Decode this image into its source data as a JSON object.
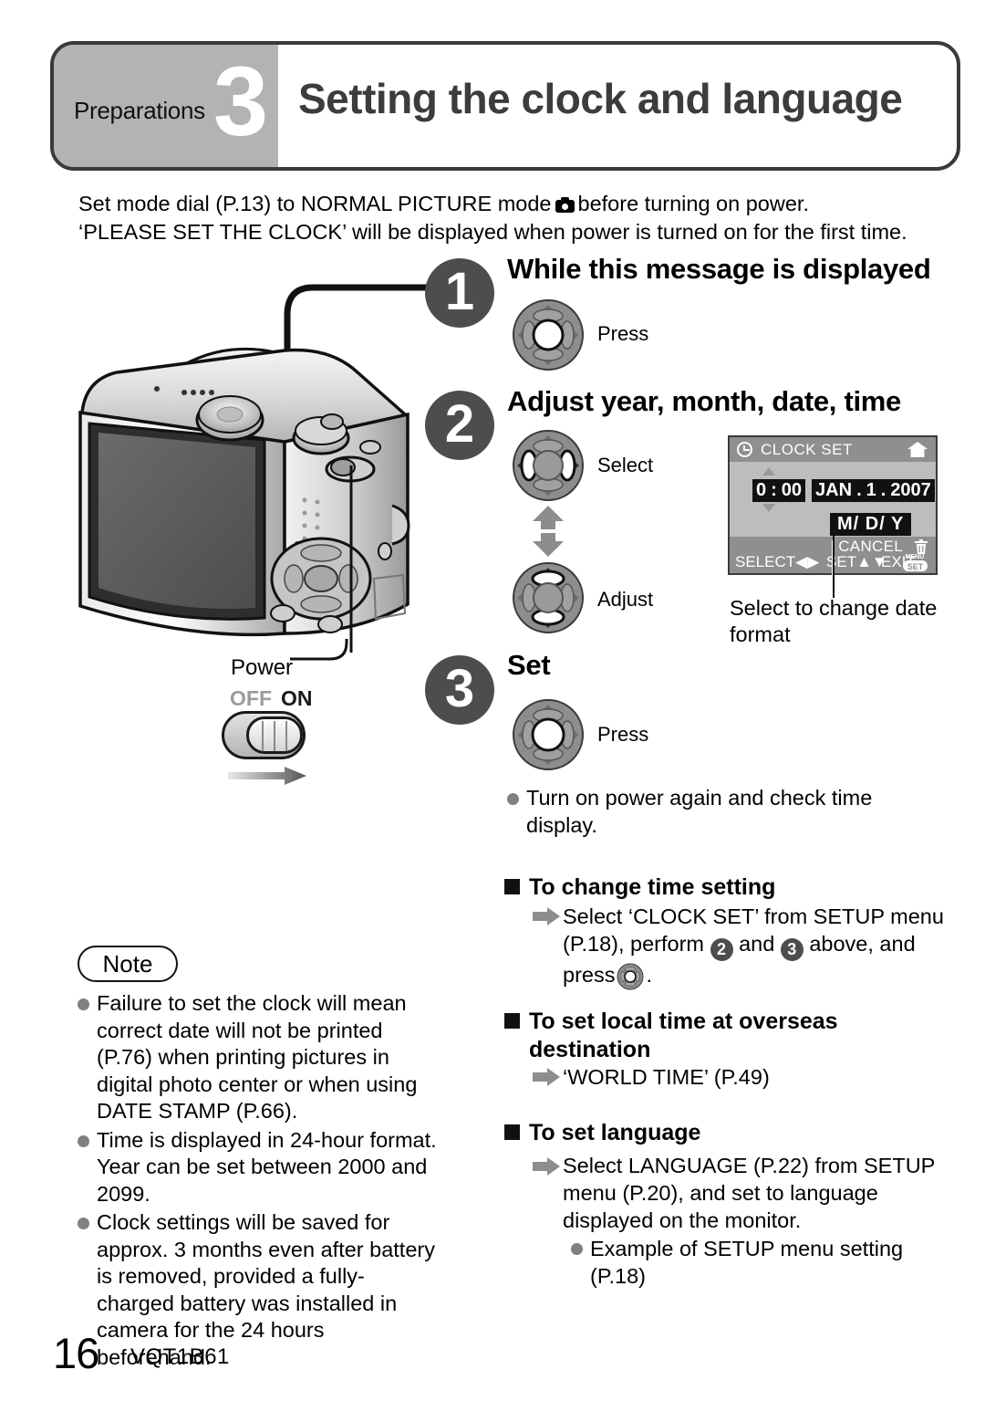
{
  "header": {
    "section_label": "Preparations",
    "step_number": "3",
    "title": "Setting the clock and language"
  },
  "intro": {
    "line1_before": "Set mode dial (P.13) to NORMAL PICTURE mode",
    "line1_after": "before turning on power.",
    "line2": "‘PLEASE SET THE CLOCK’ will be displayed when power is turned on for the first time."
  },
  "steps": [
    {
      "number": "1",
      "heading": "While this message is displayed",
      "action_label": "Press"
    },
    {
      "number": "2",
      "heading": "Adjust year, month, date, time",
      "action_label_top": "Select",
      "action_label_bottom": "Adjust"
    },
    {
      "number": "3",
      "heading": "Set",
      "action_label": "Press"
    }
  ],
  "lcd": {
    "title": "CLOCK SET",
    "clock_icon": "clock-icon",
    "home_icon": "home-icon",
    "time_hour": "0",
    "time_sep": ":",
    "time_minute": "00",
    "month": "JAN",
    "dot1": ".",
    "day": "1",
    "dot2": ".",
    "year": "2007",
    "date_format": "M/ D/ Y",
    "cancel_label": "CANCEL",
    "trash_icon": "trash-icon",
    "select_label": "SELECT",
    "set_label": "SET",
    "exit_label": "EXIT",
    "menu_set_top": "MENU",
    "menu_set_bottom": "SET",
    "caption": "Select to change date format"
  },
  "power": {
    "label": "Power",
    "off_label": "OFF",
    "on_label": "ON"
  },
  "turn_on_note": "Turn on power again and check time display.",
  "note": {
    "badge": "Note",
    "items": [
      "Failure to set the clock will mean correct date will not be printed (P.76) when printing pictures in digital photo center or when using DATE STAMP (P.66).",
      "Time is displayed in 24-hour format. Year can be set between 2000 and 2099.",
      "Clock settings will be saved for approx. 3 months even after battery is removed, provided a fully-charged battery was installed in camera for the 24 hours beforehand."
    ]
  },
  "sections": {
    "change_time": {
      "heading": "To change time setting",
      "body_part1": "Select ‘CLOCK SET’ from SETUP menu (P.18), perform",
      "step_a": "2",
      "body_part2": "and",
      "step_b": "3",
      "body_part3": "above, and press",
      "body_part4": "."
    },
    "local_time": {
      "heading": "To set local time at overseas destination",
      "body": "‘WORLD TIME’ (P.49)"
    },
    "language": {
      "heading": "To set language",
      "body": "Select LANGUAGE (P.22) from SETUP menu (P.20), and set to language displayed on the monitor.",
      "sub_bullet": "Example of SETUP menu setting (P.18)"
    }
  },
  "footer": {
    "page_number": "16",
    "document_code": "VQT1B61"
  },
  "colors": {
    "header_band": "#b3b3b3",
    "step_circle": "#4d4d4d",
    "lcd_body": "#bdbdbd",
    "lcd_bar": "#8f8f8f",
    "bullet": "#808080",
    "title_text": "#3c3c3c"
  }
}
